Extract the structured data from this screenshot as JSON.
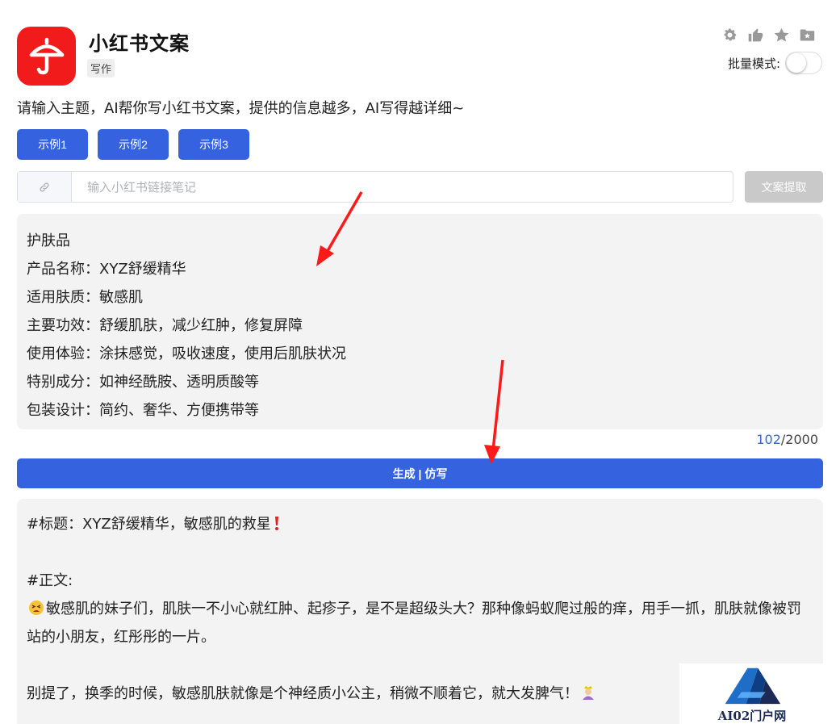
{
  "app": {
    "title": "小红书文案",
    "tag": "写作",
    "icon": "umbrella-icon",
    "brand_color": "#f11b1b"
  },
  "top_actions": {
    "icons": [
      "gear-icon",
      "thumbs-up-icon",
      "star-icon",
      "folder-star-icon"
    ],
    "batch_label": "批量模式:",
    "batch_enabled": false
  },
  "intro": "请输入主题，AI帮你写小红书文案，提供的信息越多，AI写得越详细~",
  "examples": [
    "示例1",
    "示例2",
    "示例3"
  ],
  "link": {
    "placeholder": "输入小红书链接笔记",
    "value": "",
    "extract_label": "文案提取"
  },
  "input_lines": [
    "护肤品",
    "产品名称：XYZ舒缓精华",
    "适用肤质：敏感肌",
    "主要功效：舒缓肌肤，减少红肿，修复屏障",
    "使用体验：涂抹感觉，吸收速度，使用后肌肤状况",
    "特别成分：如神经酰胺、透明质酸等",
    "包装设计：简约、奢华、方便携带等"
  ],
  "counter": {
    "current": "102",
    "max": "/2000"
  },
  "generate_label": "生成 | 仿写",
  "output": {
    "title_line": "#标题：XYZ舒缓精华，敏感肌的救星",
    "body_heading": "#正文:",
    "para1": "敏感肌的妹子们，肌肤一不小心就红肿、起疹子，是不是超级头大？那种像蚂蚁爬过般的痒，用手一抓，肌肤就像被罚站的小朋友，红彤彤的一片。",
    "para2": "别提了，换季的时候，敏感肌肤就像是个神经质小公主，稍微不顺着它，就大发脾气！"
  },
  "watermark": {
    "text": "AI02门户网",
    "accent": "#1e6ec8"
  },
  "accent_color": "#3563e0"
}
